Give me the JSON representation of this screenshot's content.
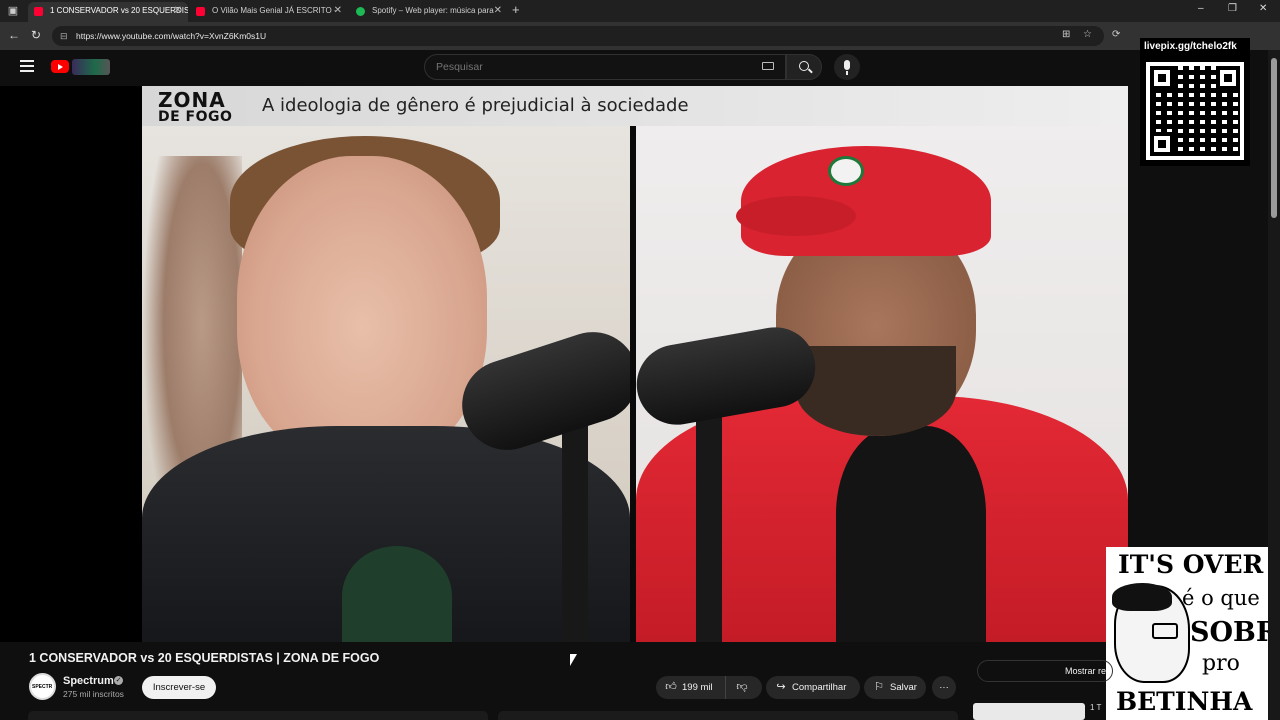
{
  "browser": {
    "tabs": [
      {
        "title": "1 CONSERVADOR vs 20 ESQUERDISTAS",
        "favicon_color": "#ff0033",
        "active": true
      },
      {
        "title": "O Vilão Mais Genial JÁ ESCRITO -",
        "favicon_color": "#ff0033",
        "active": false
      },
      {
        "title": "Spotify – Web player: música para",
        "favicon_color": "#1db954",
        "active": false
      }
    ],
    "url": "https://www.youtube.com/watch?v=XvnZ6Km0s1U"
  },
  "header": {
    "search_placeholder": "Pesquisar"
  },
  "video": {
    "banner_brand_line1": "ZONA",
    "banner_brand_line2": "DE FOGO",
    "banner_title": "A ideologia de gênero é prejudicial à sociedade"
  },
  "overlays": {
    "qr_label": "livepix.gg/tchelo2fk",
    "meme_lines": [
      "IT'S OVER",
      "é o que",
      "SOBRA",
      "pro",
      "BETINHA"
    ]
  },
  "info": {
    "title": "1 CONSERVADOR vs 20 ESQUERDISTAS | ZONA DE FOGO",
    "channel_name": "Spectrum",
    "subscribers": "275 mil inscritos",
    "subscribe_label": "Inscrever-se",
    "likes": "199 mil",
    "share_label": "Compartilhar",
    "save_label": "Salvar",
    "chat_toggle_label": "Mostrar re",
    "next_label": "1 T"
  },
  "colors": {
    "accent": "#ff0000",
    "page_bg": "#0f0f0f",
    "cap_red": "#d92330"
  }
}
